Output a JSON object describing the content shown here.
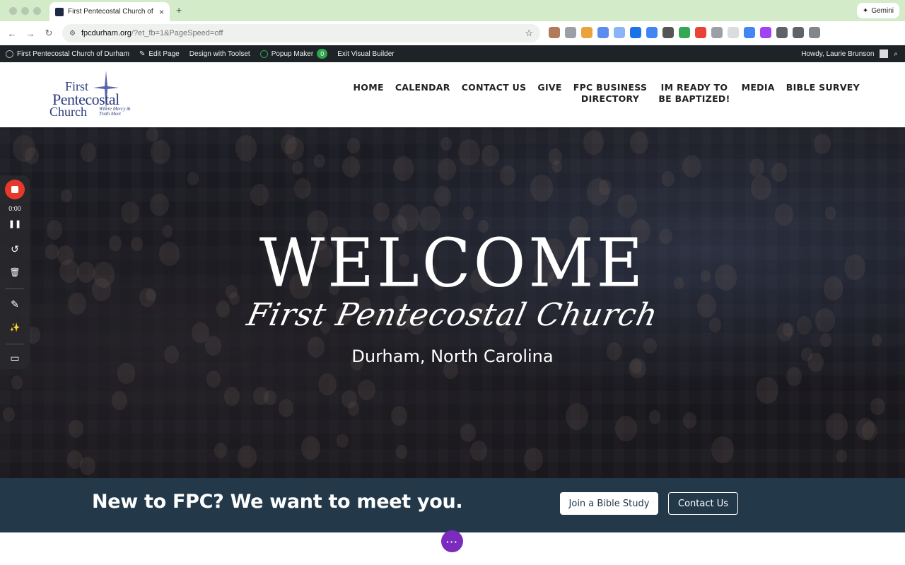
{
  "browser": {
    "tab_title": "First Pentecostal Church of D",
    "tab_close": "×",
    "new_tab": "+",
    "gemini_label": "Gemini",
    "gemini_icon": "✦",
    "url_main": "fpcdurham.org",
    "url_rest": "/?et_fb=1&PageSpeed=off",
    "back": "←",
    "forward": "→",
    "reload": "↻",
    "tune": "⚙",
    "star": "☆",
    "extension_colors": [
      "#b07b5a",
      "#9aa0a6",
      "#e8a33d",
      "#5b8def",
      "#8ab4f8",
      "#1a73e8",
      "#4285f4",
      "#555555",
      "#34a853",
      "#ea4335",
      "#9aa0a6",
      "#dadce0",
      "#4285f4",
      "#a142f4",
      "#5f6368",
      "#5f6368",
      "#80868b"
    ]
  },
  "wpbar": {
    "site_name": "First Pentecostal Church of Durham",
    "edit_page": "Edit Page",
    "design_toolset": "Design with Toolset",
    "popup_maker": "Popup Maker",
    "popup_count": "0",
    "exit_builder": "Exit Visual Builder",
    "howdy": "Howdy, Laurie Brunson",
    "edit_icon": "✎",
    "search_icon": "⌕"
  },
  "logo": {
    "line1": "First",
    "line2": "Pentecostal",
    "line3": "Church",
    "tagline": "Where Mercy & Truth Meet"
  },
  "nav": {
    "items": [
      "HOME",
      "CALENDAR",
      "CONTACT US",
      "GIVE"
    ],
    "directory_l1": "FPC BUSINESS",
    "directory_l2": "DIRECTORY",
    "baptized_l1": "IM READY TO",
    "baptized_l2": "BE BAPTIZED!",
    "media": "MEDIA",
    "bible_survey": "BIBLE SURVEY"
  },
  "hero": {
    "welcome": "WELCOME",
    "church": "First Pentecostal Church",
    "city": "Durham, North Carolina"
  },
  "recorder": {
    "time": "0:00",
    "pause": "❚❚",
    "restart": "↺",
    "trash": "🗑",
    "pen": "✎",
    "effects": "✨",
    "camera": "▭"
  },
  "cta": {
    "headline": "New to FPC? We want to meet you.",
    "bible_study": "Join a Bible Study",
    "contact": "Contact Us"
  },
  "fab": {
    "label": "···"
  }
}
